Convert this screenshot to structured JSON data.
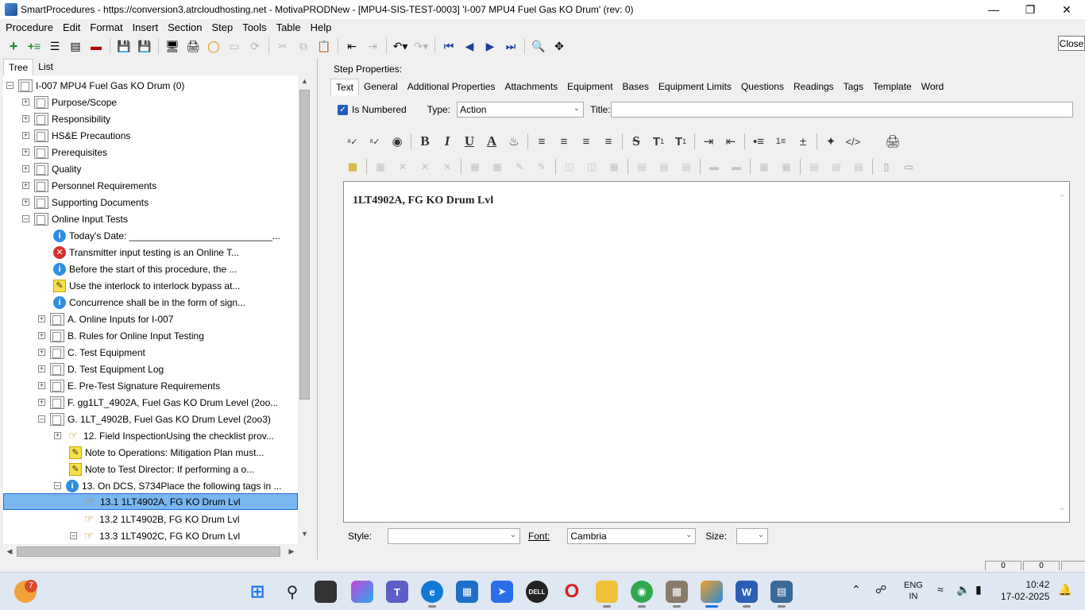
{
  "window": {
    "title": "SmartProcedures - https://conversion3.atrcloudhosting.net - MotivaPRODNew - [MPU4-SIS-TEST-0003] 'I-007 MPU4 Fuel Gas KO Drum' (rev: 0)"
  },
  "menu": [
    "Procedure",
    "Edit",
    "Format",
    "Insert",
    "Section",
    "Step",
    "Tools",
    "Table",
    "Help"
  ],
  "close_label": "Close",
  "left_tabs": [
    "Tree",
    "List"
  ],
  "tree": [
    {
      "label": "I-007 MPU4 Fuel Gas KO Drum (0)"
    },
    {
      "label": "Purpose/Scope"
    },
    {
      "label": "Responsibility"
    },
    {
      "label": "HS&E Precautions"
    },
    {
      "label": "Prerequisites"
    },
    {
      "label": "Quality"
    },
    {
      "label": "Personnel Requirements"
    },
    {
      "label": "Supporting Documents"
    },
    {
      "label": "Online Input Tests"
    },
    {
      "label": "Today's Date: ___________________________..."
    },
    {
      "label": "Transmitter input testing is an Online T..."
    },
    {
      "label": "Before the start of this procedure, the ..."
    },
    {
      "label": "Use the interlock to interlock bypass at..."
    },
    {
      "label": "Concurrence shall be in the form of sign..."
    },
    {
      "label": "A. Online Inputs for I-007"
    },
    {
      "label": "B. Rules for Online Input Testing"
    },
    {
      "label": "C. Test Equipment"
    },
    {
      "label": "D. Test Equipment Log"
    },
    {
      "label": "E. Pre-Test Signature Requirements"
    },
    {
      "label": "F. gg1LT_4902A, Fuel Gas KO Drum Level (2oo..."
    },
    {
      "label": "G. 1LT_4902B, Fuel Gas KO Drum Level (2oo3)"
    },
    {
      "label": "12. Field InspectionUsing the checklist prov..."
    },
    {
      "label": "Note to Operations: Mitigation Plan must..."
    },
    {
      "label": "Note to Test Director: If performing a o..."
    },
    {
      "label": "13. On DCS, S734Place the following tags in ..."
    },
    {
      "label": "13.1 1LT4902A, FG KO Drum Lvl"
    },
    {
      "label": "13.2 1LT4902B, FG KO Drum Lvl"
    },
    {
      "label": "13.3 1LT4902C, FG KO Drum Lvl"
    }
  ],
  "step_properties_label": "Step Properties:",
  "step_tabs": [
    "Text",
    "General",
    "Additional Properties",
    "Attachments",
    "Equipment",
    "Bases",
    "Equipment Limits",
    "Questions",
    "Readings",
    "Tags",
    "Template",
    "Word"
  ],
  "is_numbered_label": "Is Numbered",
  "type_label": "Type:",
  "type_value": "Action",
  "title_label": "Title:",
  "format_toolbar": {
    "t1": "T",
    "t1_sup": "1",
    "t2": "T",
    "t2_sub": "1",
    "code": "</>"
  },
  "editor_text": "1LT4902A, FG KO Drum Lvl",
  "style_label": "Style:",
  "font_label": "Font:",
  "font_value": "Cambria",
  "size_label": "Size:",
  "status": [
    "0",
    "0"
  ],
  "taskbar": {
    "badge": "7",
    "lang_top": "ENG",
    "lang_bottom": "IN",
    "time": "10:42",
    "date": "17-02-2025"
  }
}
